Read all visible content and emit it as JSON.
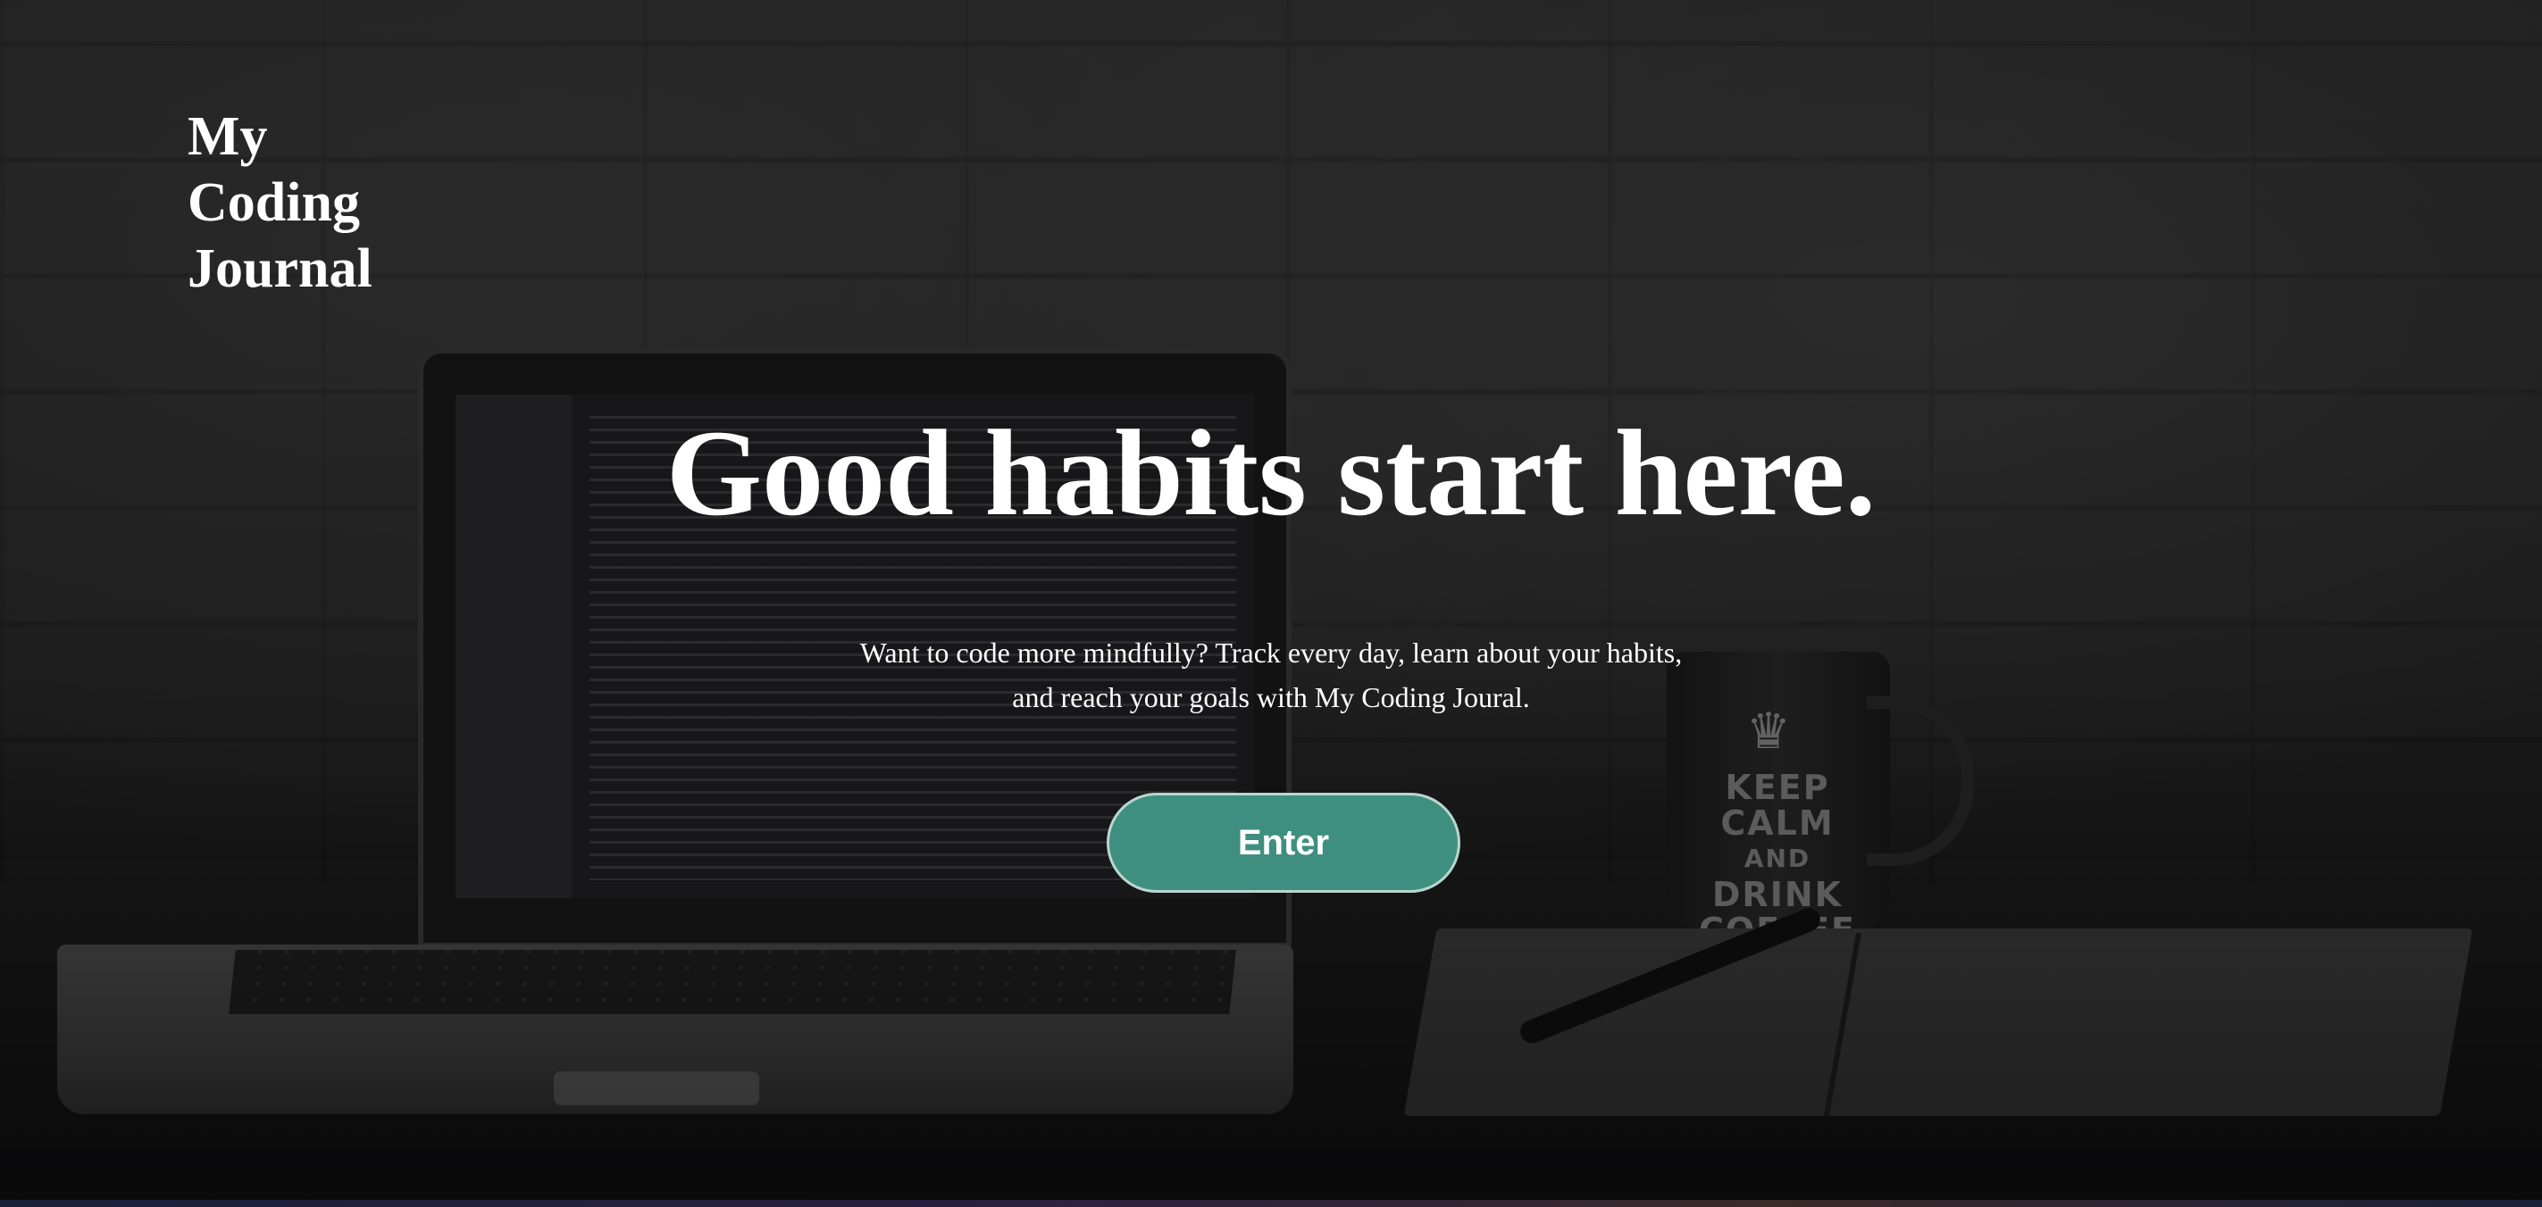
{
  "logo": {
    "line1": "My",
    "line2": "Coding",
    "line3": "Journal"
  },
  "hero": {
    "headline": "Good habits start here.",
    "subtext_line1": "Want to code more mindfully? Track every day, learn about your habits,",
    "subtext_line2": "and reach your goals with My Coding Joural.",
    "enter_label": "Enter"
  },
  "background": {
    "mug_text_line1": "KEEP",
    "mug_text_line2": "CALM",
    "mug_text_line3": "AND",
    "mug_text_line4": "DRINK",
    "mug_text_line5": "COFFEE"
  },
  "colors": {
    "button": "#3f8f80",
    "button_border": "#b9d6d0",
    "text": "#ffffff"
  }
}
